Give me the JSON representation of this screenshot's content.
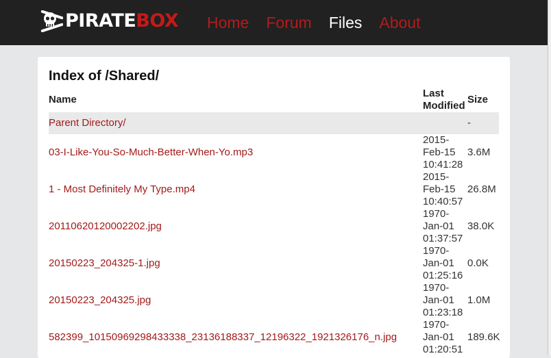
{
  "header": {
    "logo_part1": "PIRATE",
    "logo_part2": "BOX",
    "nav": [
      {
        "label": "Home",
        "active": false
      },
      {
        "label": "Forum",
        "active": false
      },
      {
        "label": "Files",
        "active": true
      },
      {
        "label": "About",
        "active": false
      }
    ]
  },
  "colors": {
    "header_bg": "#212121",
    "accent": "#b11c1c",
    "page_bg": "#e6e7e9"
  },
  "listing": {
    "title": "Index of /Shared/",
    "columns": {
      "name": "Name",
      "modified": "Last Modified",
      "size": "Size"
    },
    "parent": {
      "name": "Parent Directory",
      "suffix": "/",
      "size": "-"
    },
    "files": [
      {
        "name": "03-I-Like-You-So-Much-Better-When-Yo.mp3",
        "modified": "2015-Feb-15 10:41:28",
        "size": "3.6M"
      },
      {
        "name": "1 - Most Definitely My Type.mp4",
        "modified": "2015-Feb-15 10:40:57",
        "size": "26.8M"
      },
      {
        "name": "20110620120002202.jpg",
        "modified": "1970-Jan-01 01:37:57",
        "size": "38.0K"
      },
      {
        "name": "20150223_204325-1.jpg",
        "modified": "1970-Jan-01 01:25:16",
        "size": "0.0K"
      },
      {
        "name": "20150223_204325.jpg",
        "modified": "1970-Jan-01 01:23:18",
        "size": "1.0M"
      },
      {
        "name": "582399_10150969298433338_23136188337_12196322_1921326176_n.jpg",
        "modified": "1970-Jan-01 01:20:51",
        "size": "189.6K"
      }
    ]
  }
}
